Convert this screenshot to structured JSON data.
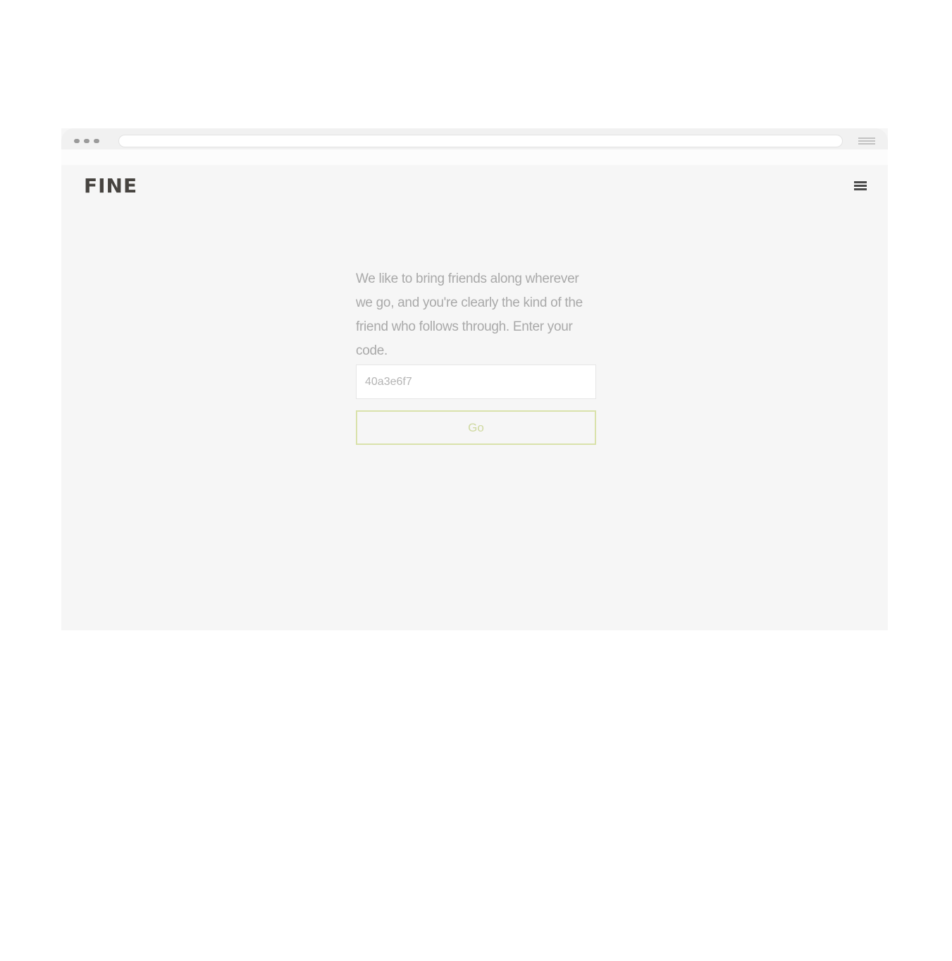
{
  "header": {
    "logo": "FINE",
    "menu_icon": "hamburger-menu-icon"
  },
  "main": {
    "intro_text": "We like to bring friends along wherever we go, and you're clearly the kind of the friend who follows through. Enter your code.",
    "code_input": {
      "value": "",
      "placeholder": "40a3e6f7"
    },
    "go_button_label": "Go"
  },
  "colors": {
    "page_background": "#f6f6f6",
    "logo": "#474440",
    "body_text": "#a9a9a9",
    "button_accent": "#d9e2ab"
  }
}
